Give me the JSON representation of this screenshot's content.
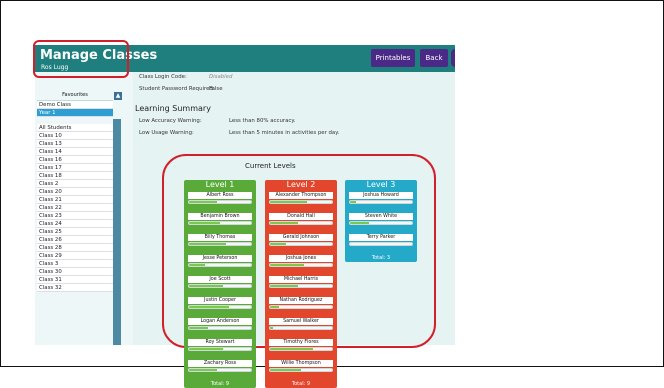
{
  "header": {
    "title": "Manage Classes",
    "subtitle": "Ros Lugg",
    "printables_label": "Printables",
    "back_label": "Back"
  },
  "class_info": {
    "login_code_label": "Class Login Code:",
    "login_code_value": "Disabled",
    "password_label": "Student Password Required:",
    "password_value": "False"
  },
  "learning_summary": {
    "title": "Learning Summary",
    "low_accuracy_label": "Low Accuracy Warning:",
    "low_accuracy_value": "Less than 80% accuracy.",
    "low_usage_label": "Low Usage Warning:",
    "low_usage_value": "Less than 5 minutes in activities per day."
  },
  "sidebar": {
    "favourites_header": "Favourites",
    "favourites": [
      "Demo Class",
      "Year 1"
    ],
    "selected": "Year 1",
    "classes": [
      "All Students",
      "Class 10",
      "Class 13",
      "Class 14",
      "Class 16",
      "Class 17",
      "Class 18",
      "Class 2",
      "Class 20",
      "Class 21",
      "Class 22",
      "Class 23",
      "Class 24",
      "Class 25",
      "Class 26",
      "Class 28",
      "Class 29",
      "Class 3",
      "Class 30",
      "Class 31",
      "Class 32"
    ]
  },
  "levels": {
    "title": "Current Levels",
    "columns": [
      {
        "name": "Level 1",
        "color": "#5aaa3a",
        "total": "Total: 9",
        "students": [
          {
            "name": "Albert Ross",
            "progress": 0.45
          },
          {
            "name": "Benjamin Brown",
            "progress": 0.5
          },
          {
            "name": "Billy Thomas",
            "progress": 0.6
          },
          {
            "name": "Jesse Peterson",
            "progress": 0.25
          },
          {
            "name": "Joe Scott",
            "progress": 0.55
          },
          {
            "name": "Justin Cooper",
            "progress": 0.65
          },
          {
            "name": "Logan Anderson",
            "progress": 0.3
          },
          {
            "name": "Roy Stewart",
            "progress": 0.55
          },
          {
            "name": "Zachary Ross",
            "progress": 0.45
          }
        ]
      },
      {
        "name": "Level 2",
        "color": "#e2462c",
        "total": "Total: 9",
        "students": [
          {
            "name": "Alexander Thompson",
            "progress": 0.6
          },
          {
            "name": "Donald Hall",
            "progress": 0.45
          },
          {
            "name": "Gerald Johnson",
            "progress": 0.25
          },
          {
            "name": "Joshua Jones",
            "progress": 0.55
          },
          {
            "name": "Michael Harris",
            "progress": 0.45
          },
          {
            "name": "Nathan Rodriguez",
            "progress": 0.15
          },
          {
            "name": "Samuel Walker",
            "progress": 0.05
          },
          {
            "name": "Timothy Flores",
            "progress": 0.7
          },
          {
            "name": "Willie Thompson",
            "progress": 0.5
          }
        ]
      },
      {
        "name": "Level 3",
        "color": "#24a9c9",
        "total": "Total: 3",
        "students": [
          {
            "name": "Joshua Howard",
            "progress": 0.1
          },
          {
            "name": "Steven White",
            "progress": 0.3
          },
          {
            "name": "Terry Parker",
            "progress": 0.0
          }
        ]
      }
    ]
  }
}
